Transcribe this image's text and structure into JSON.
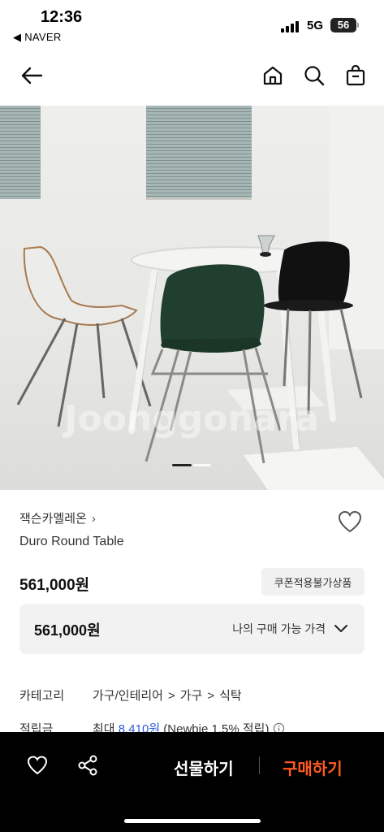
{
  "status": {
    "time": "12:36",
    "back_app": "◀ NAVER",
    "network": "5G",
    "battery": "56"
  },
  "nav": {
    "back_icon": "arrow-left-icon",
    "home_icon": "home-icon",
    "search_icon": "search-icon",
    "cart_icon": "shopping-bag-icon"
  },
  "hero": {
    "watermark": "Joonggonara",
    "slide_indicator": {
      "count": 2,
      "active": 1
    }
  },
  "product": {
    "seller": "잭슨카멜레온",
    "seller_chevron": "›",
    "name": "Duro Round Table",
    "price": "561,000원",
    "coupon_label": "쿠폰적용불가상품",
    "my_price": "561,000원",
    "my_price_label": "나의 구매 가능 가격"
  },
  "details": {
    "category_label": "카테고리",
    "category_path": [
      "가구/인테리어",
      "가구",
      "식탁"
    ],
    "category_sep": ">",
    "points_label": "적립금",
    "points_prefix": "최대",
    "points_amount": "8,410원",
    "points_suffix": "(Newbie 1.5% 적립)"
  },
  "bottom": {
    "gift_label": "선물하기",
    "buy_label": "구매하기"
  },
  "colors": {
    "buy_accent": "#ff5a1f",
    "link_blue": "#2a5bd7"
  }
}
